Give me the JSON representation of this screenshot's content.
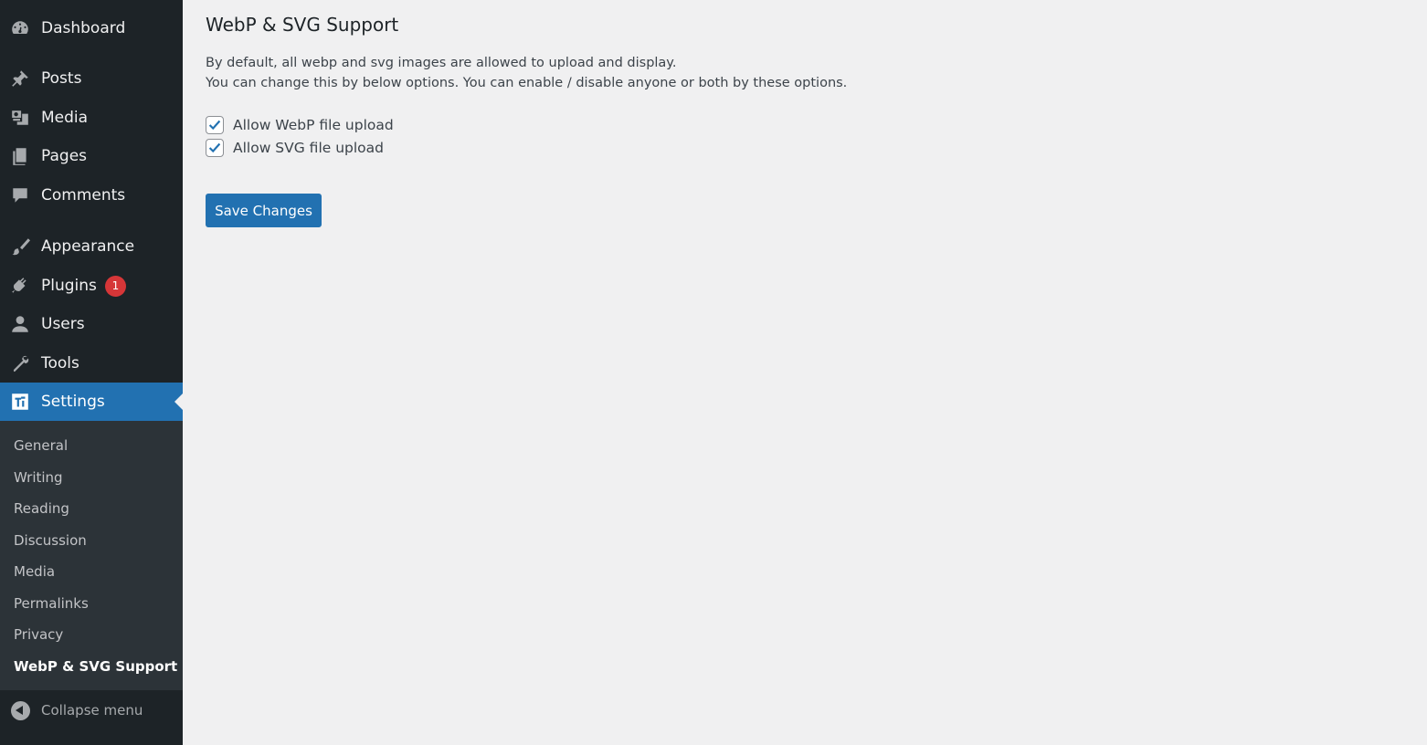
{
  "sidebar": {
    "items": [
      {
        "label": "Dashboard",
        "icon": "dashboard-icon"
      },
      {
        "label": "Posts",
        "icon": "pushpin-icon"
      },
      {
        "label": "Media",
        "icon": "media-icon"
      },
      {
        "label": "Pages",
        "icon": "pages-icon"
      },
      {
        "label": "Comments",
        "icon": "comment-icon"
      },
      {
        "label": "Appearance",
        "icon": "paintbrush-icon"
      },
      {
        "label": "Plugins",
        "icon": "plugin-icon",
        "badge": "1"
      },
      {
        "label": "Users",
        "icon": "user-icon"
      },
      {
        "label": "Tools",
        "icon": "wrench-icon"
      },
      {
        "label": "Settings",
        "icon": "settings-icon",
        "current": true
      }
    ],
    "submenu": [
      "General",
      "Writing",
      "Reading",
      "Discussion",
      "Media",
      "Permalinks",
      "Privacy",
      "WebP & SVG Support"
    ],
    "submenu_current": "WebP & SVG Support",
    "collapse_label": "Collapse menu"
  },
  "main": {
    "title": "WebP & SVG Support",
    "description_line1": "By default, all webp and svg images are allowed to upload and display.",
    "description_line2": "You can change this by below options. You can enable / disable anyone or both by these options.",
    "options": [
      {
        "label": "Allow WebP file upload",
        "checked": true
      },
      {
        "label": "Allow SVG file upload",
        "checked": true
      }
    ],
    "save_label": "Save Changes"
  },
  "colors": {
    "sidebar_bg": "#1d2327",
    "submenu_bg": "#2c3338",
    "accent": "#2271b1",
    "badge": "#d63638",
    "page_bg": "#f0f0f1"
  }
}
